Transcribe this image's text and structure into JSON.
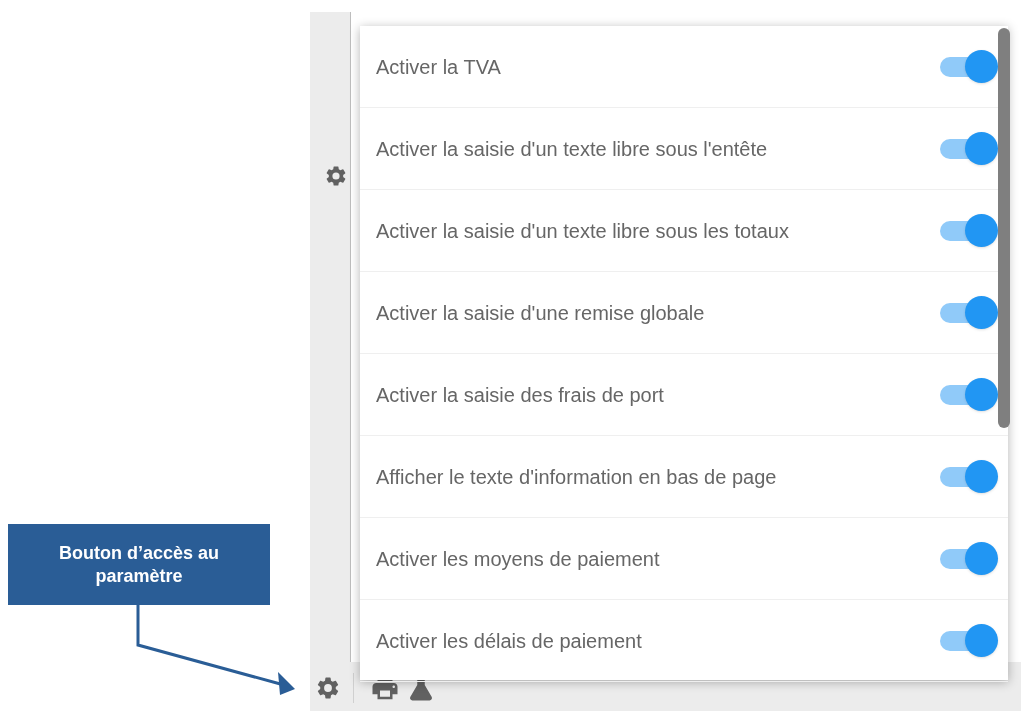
{
  "callout": {
    "text": "Bouton d’accès au paramètre"
  },
  "settings_menu": {
    "items": [
      {
        "label": "Activer la TVA",
        "on": true
      },
      {
        "label": "Activer la saisie d'un texte libre sous l'entête",
        "on": true
      },
      {
        "label": "Activer la saisie d'un texte libre sous les totaux",
        "on": true
      },
      {
        "label": "Activer la saisie d'une remise globale",
        "on": true
      },
      {
        "label": "Activer la saisie des frais de port",
        "on": true
      },
      {
        "label": "Afficher le texte d'information en bas de page",
        "on": true
      },
      {
        "label": "Activer les moyens de paiement",
        "on": true
      },
      {
        "label": "Activer les délais de paiement",
        "on": true
      }
    ]
  }
}
